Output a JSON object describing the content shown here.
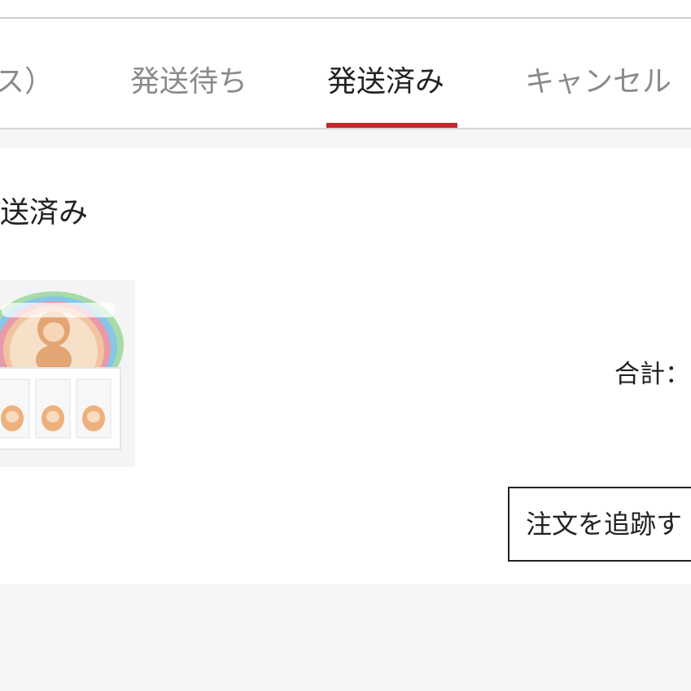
{
  "tabs": [
    {
      "label": "ス）",
      "active": false
    },
    {
      "label": "発送待ち",
      "active": false
    },
    {
      "label": "発送済み",
      "active": true
    },
    {
      "label": "キャンセル",
      "active": false
    }
  ],
  "order": {
    "status_label": "発送済み",
    "product_image": "product-box-thumbnail",
    "total_label": "合計：",
    "track_button_label": "注文を追跡す"
  },
  "colors": {
    "accent": "#c8262f",
    "background": "#f5f5f5",
    "card": "#ffffff",
    "active_text": "#222222",
    "inactive_text": "#8a8a8a"
  }
}
